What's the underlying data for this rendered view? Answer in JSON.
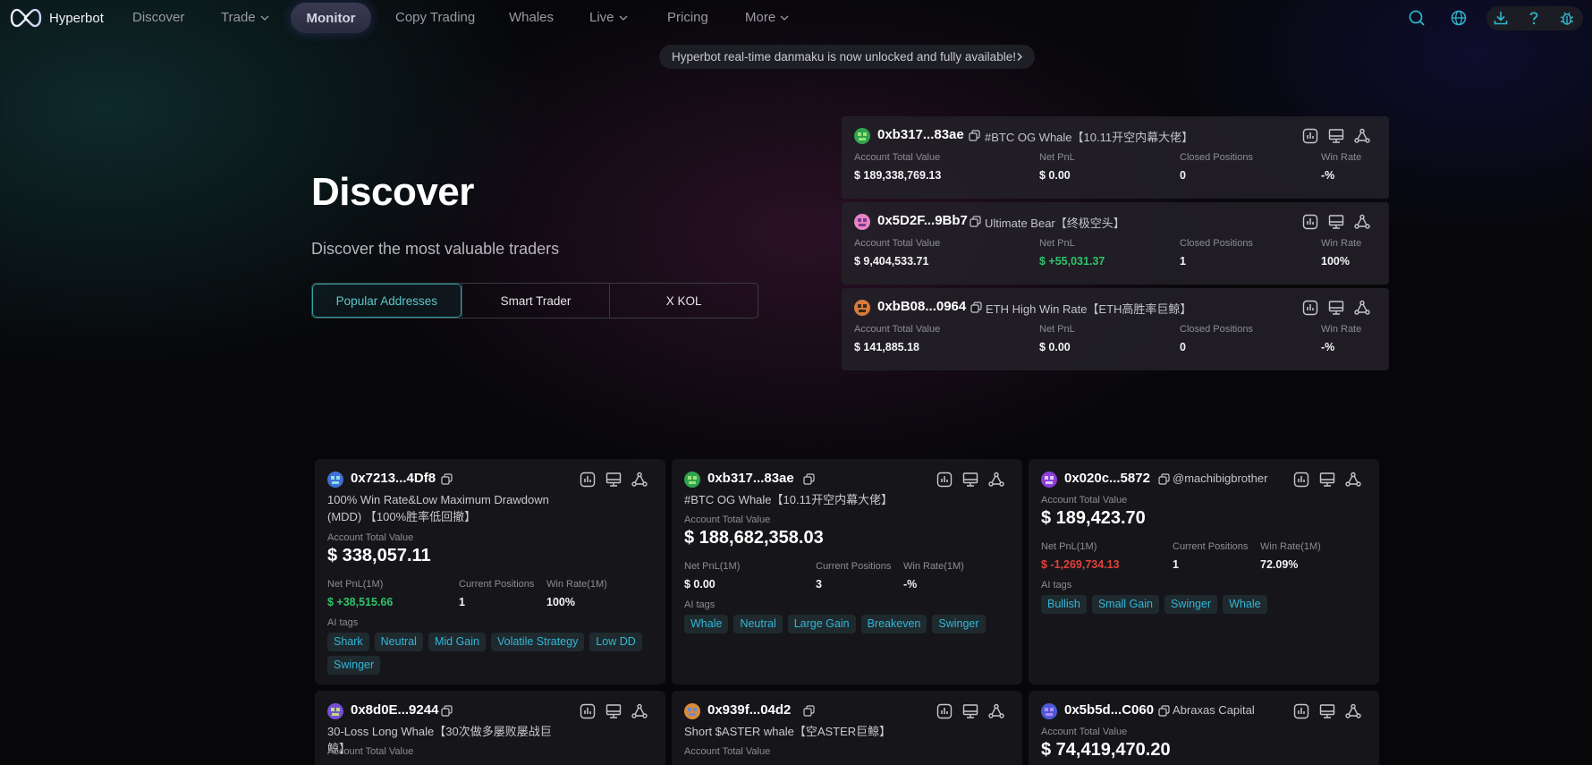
{
  "colors": {
    "accent": "#2fa3a8",
    "positive": "#2fc36a",
    "negative": "#e3413b",
    "tag": "#33b6d6"
  },
  "nav": {
    "brand": "Hyperbot",
    "items": [
      {
        "label": "Discover"
      },
      {
        "label": "Trade",
        "dropdown": true
      },
      {
        "label": "Monitor",
        "active": true
      },
      {
        "label": "Copy Trading"
      },
      {
        "label": "Whales"
      },
      {
        "label": "Live",
        "dropdown": true
      },
      {
        "label": "Pricing"
      },
      {
        "label": "More",
        "dropdown": true
      }
    ],
    "icons": [
      "search-icon",
      "globe-icon",
      "download-icon",
      "help-icon",
      "bug-icon"
    ]
  },
  "banner": {
    "text": "Hyperbot real-time danmaku is now unlocked and fully available!"
  },
  "hero": {
    "title": "Discover",
    "subtitle": "Discover the most valuable traders",
    "tabs": [
      {
        "label": "Popular Addresses",
        "active": true
      },
      {
        "label": "Smart Trader"
      },
      {
        "label": "X KOL"
      }
    ]
  },
  "featured": [
    {
      "address": "0xb317...83ae",
      "nickname": "#BTC OG Whale【10.11开空内幕大佬】",
      "labels": [
        "Account Total Value",
        "Net PnL",
        "Closed Positions",
        "Win Rate"
      ],
      "values": [
        "$ 189,338,769.13",
        "$ 0.00",
        "0",
        "-%"
      ]
    },
    {
      "address": "0x5D2F...9Bb7",
      "nickname": "Ultimate Bear【终极空头】",
      "labels": [
        "Account Total Value",
        "Net PnL",
        "Closed Positions",
        "Win Rate"
      ],
      "values": [
        "$ 9,404,533.71",
        "$ +55,031.37",
        "1",
        "100%"
      ]
    },
    {
      "address": "0xbB08...0964",
      "nickname": "ETH High Win Rate【ETH高胜率巨鲸】",
      "labels": [
        "Account Total Value",
        "Net PnL",
        "Closed Positions",
        "Win Rate"
      ],
      "values": [
        "$ 141,885.18",
        "$ 0.00",
        "0",
        "-%"
      ]
    }
  ],
  "traders": [
    {
      "address": "0x7213...4Df8",
      "description": "100% Win Rate&Low Maximum Drawdown (MDD) 【100%胜率低回撤】",
      "total_label": "Account Total Value",
      "total": "$ 338,057.11",
      "pnl_label": "Net PnL(1M)",
      "pnl": "$ +38,515.66",
      "positions_label": "Current Positions",
      "positions": "1",
      "winrate_label": "Win Rate(1M)",
      "winrate": "100%",
      "tags_label": "AI tags",
      "tags": [
        "Shark",
        "Neutral",
        "Mid Gain",
        "Volatile Strategy",
        "Low DD",
        "Swinger"
      ]
    },
    {
      "address": "0xb317...83ae",
      "description": "#BTC OG Whale【10.11开空内幕大佬】",
      "total_label": "Account Total Value",
      "total": "$ 188,682,358.03",
      "pnl_label": "Net PnL(1M)",
      "pnl": "$ 0.00",
      "positions_label": "Current Positions",
      "positions": "3",
      "winrate_label": "Win Rate(1M)",
      "winrate": "-%",
      "tags_label": "AI tags",
      "tags": [
        "Whale",
        "Neutral",
        "Large Gain",
        "Breakeven",
        "Swinger"
      ]
    },
    {
      "address": "0x020c...5872",
      "nickname": "@machibigbrother",
      "total_label": "Account Total Value",
      "total": "$ 189,423.70",
      "pnl_label": "Net PnL(1M)",
      "pnl": "$ -1,269,734.13",
      "positions_label": "Current Positions",
      "positions": "1",
      "winrate_label": "Win Rate(1M)",
      "winrate": "72.09%",
      "tags_label": "AI tags",
      "tags": [
        "Bullish",
        "Small Gain",
        "Swinger",
        "Whale"
      ]
    },
    {
      "address": "0x8d0E...9244",
      "description": "30-Loss Long Whale【30次做多屡败屡战巨鲸】",
      "total_label": "Account Total Value"
    },
    {
      "address": "0x939f...04d2",
      "description": "Short $ASTER whale【空ASTER巨鲸】",
      "total_label": "Account Total Value"
    },
    {
      "address": "0x5b5d...C060",
      "nickname": "Abraxas Capital",
      "total_label": "Account Total Value",
      "total": "$ 74,419,470.20"
    }
  ]
}
